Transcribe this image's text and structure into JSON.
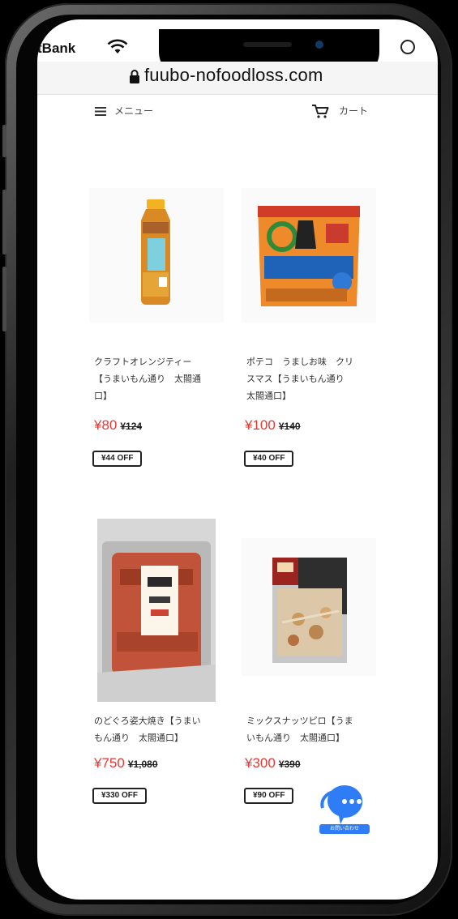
{
  "status": {
    "carrier": "tBank"
  },
  "browser": {
    "url": "fuubo-nofoodloss.com"
  },
  "header": {
    "menu_label": "メニュー",
    "cart_label": "カート"
  },
  "products": [
    {
      "name_lines": [
        "クラフトオレンジティー",
        "【うまいもん通り　太閤通",
        "口】"
      ],
      "price": "¥80",
      "original_price": "¥124",
      "discount": "¥44 OFF"
    },
    {
      "name_lines": [
        "ポテコ　うましお味　クリ",
        "スマス【うまいもん通り",
        "太閤通口】"
      ],
      "price": "¥100",
      "original_price": "¥140",
      "discount": "¥40 OFF"
    },
    {
      "name_lines": [
        "のどぐろ姿大焼き【うまい",
        "もん通り　太閤通口】"
      ],
      "price": "¥750",
      "original_price": "¥1,080",
      "discount": "¥330 OFF"
    },
    {
      "name_lines": [
        "ミックスナッツピロ【うま",
        "いもん通り　太閤通口】"
      ],
      "price": "¥300",
      "original_price": "¥390",
      "discount": "¥90 OFF"
    }
  ],
  "chat_widget": {
    "label": "お問い合わせ"
  }
}
